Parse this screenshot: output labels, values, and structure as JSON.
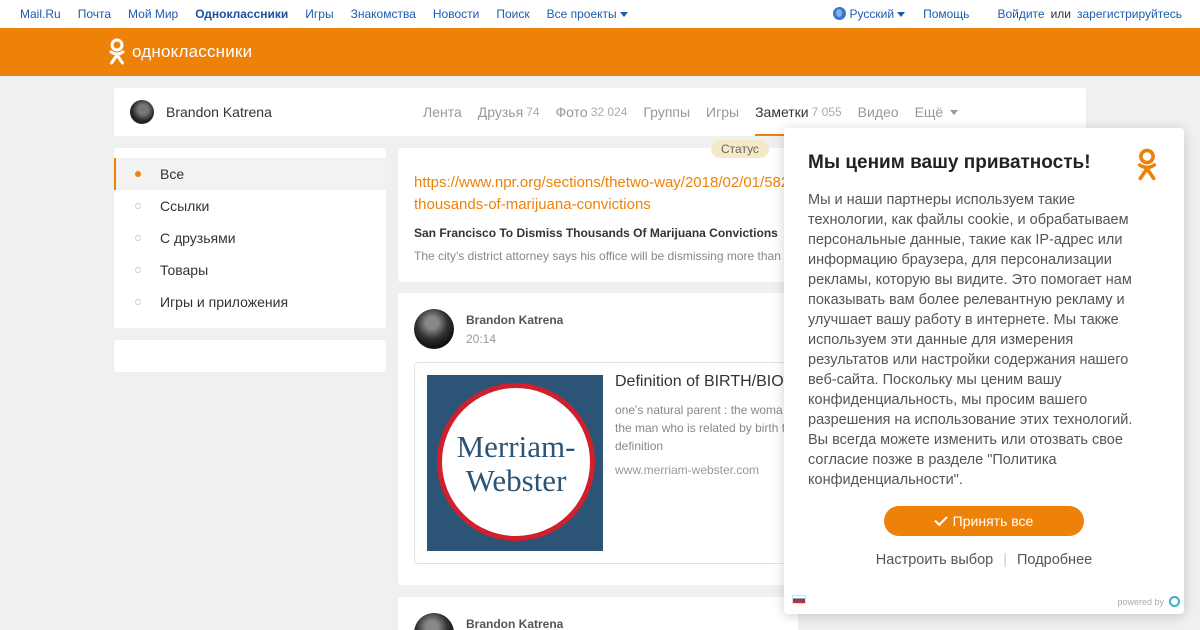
{
  "portal": {
    "left_links": [
      "Mail.Ru",
      "Почта",
      "Мой Мир",
      "Одноклассники",
      "Игры",
      "Знакомства",
      "Новости",
      "Поиск",
      "Все проекты"
    ],
    "language": "Русский",
    "help": "Помощь",
    "login": "Войдите",
    "or": "или",
    "register": "зарегистрируйтесь"
  },
  "header": {
    "logo_text": "одноклассники"
  },
  "profile": {
    "name": "Brandon Katrena",
    "tabs": [
      {
        "label": "Лента",
        "count": ""
      },
      {
        "label": "Друзья",
        "count": "74"
      },
      {
        "label": "Фото",
        "count": "32 024"
      },
      {
        "label": "Группы",
        "count": ""
      },
      {
        "label": "Игры",
        "count": ""
      },
      {
        "label": "Заметки",
        "count": "7 055"
      },
      {
        "label": "Видео",
        "count": ""
      },
      {
        "label": "Ещё",
        "count": ""
      }
    ]
  },
  "filters": [
    "Все",
    "Ссылки",
    "С друзьями",
    "Товары",
    "Игры и приложения"
  ],
  "status_badge": "Статус",
  "post1": {
    "link_line1": "https://www.npr.org/sections/thetwo-way/2018/02/01/582",
    "link_line2": "thousands-of-marijuana-convictions",
    "title": "San Francisco To Dismiss Thousands Of Marijuana Convictions",
    "desc": "The city's district attorney says his office will be dismissing more than"
  },
  "post2": {
    "author": "Brandon Katrena",
    "time": "20:14",
    "logo_line1": "Merriam-",
    "logo_line2": "Webster",
    "title": "Definition of BIRTH/BIO",
    "desc_line1": "one's natural parent : the woma",
    "desc_line2": "the man who is related by birth t",
    "desc_line3": "definition",
    "site": "www.merriam-webster.com"
  },
  "post3": {
    "author": "Brandon Katrena"
  },
  "privacy": {
    "title": "Мы ценим вашу приватность!",
    "body_lines": [
      "Мы и наши партнеры используем такие",
      "технологии, как файлы cookie, и обрабатываем",
      "персональные данные, такие как IP-адрес или",
      "информацию браузера, для персонализации",
      "рекламы, которую вы видите. Это помогает нам",
      "показывать вам более релевантную рекламу и",
      "улучшает вашу работу в интернете. Мы также",
      "используем эти данные для измерения",
      "результатов или настройки содержания нашего",
      "веб-сайта. Поскольку мы ценим вашу",
      "конфиденциальность, мы просим вашего",
      "разрешения на использование этих технологий.",
      "Вы всегда можете изменить или отозвать свое",
      "согласие позже в разделе \"Политика",
      "конфиденциальности\"."
    ],
    "accept": "Принять все",
    "customize": "Настроить выбор",
    "more": "Подробнее",
    "powered": "powered by"
  },
  "colors": {
    "accent": "#ee8208",
    "link": "#1f5bab"
  }
}
